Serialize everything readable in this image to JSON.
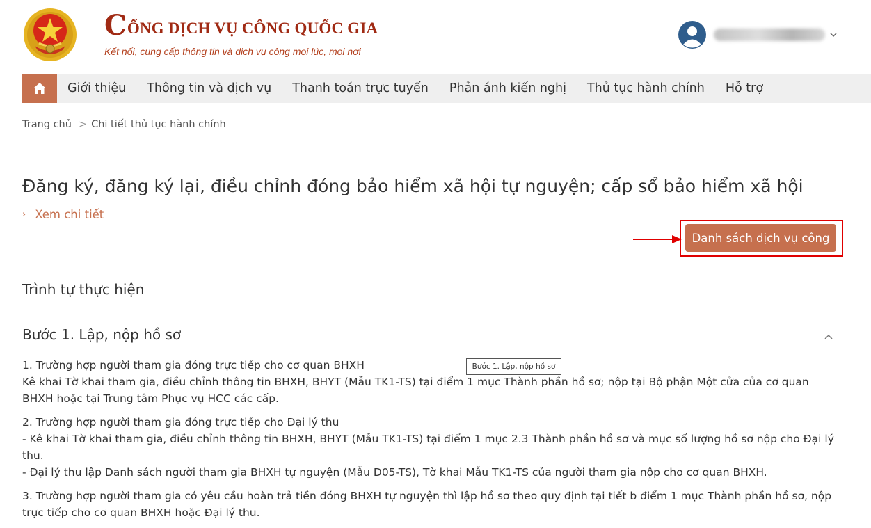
{
  "header": {
    "brand_initial": "C",
    "brand_rest": "ỔNG DỊCH VỤ CÔNG QUỐC GIA",
    "brand_subtitle": "Kết nối, cung cấp thông tin và dịch vụ công mọi lúc, mọi nơi",
    "user_icon": "user-avatar-icon",
    "dropdown_icon": "chevron-down-icon"
  },
  "nav": {
    "home_icon": "home-icon",
    "items": [
      "Giới thiệu",
      "Thông tin và dịch vụ",
      "Thanh toán trực tuyến",
      "Phản ánh kiến nghị",
      "Thủ tục hành chính",
      "Hỗ trợ"
    ]
  },
  "breadcrumb": {
    "home": "Trang chủ",
    "separator": ">",
    "current": "Chi tiết thủ tục hành chính"
  },
  "procedure": {
    "title": "Đăng ký, đăng ký lại, điều chỉnh đóng bảo hiểm xã hội tự nguyện; cấp sổ bảo hiểm xã hội",
    "detail_link_chevron": "›",
    "detail_link": "Xem chi tiết",
    "service_list_button": "Danh sách dịch vụ công"
  },
  "sequence": {
    "heading": "Trình tự thực hiện",
    "step_title": "Bước 1. Lập, nộp hồ sơ",
    "tooltip": "Bước 1. Lập, nộp hồ sơ",
    "paragraphs": [
      {
        "lines": [
          "1. Trường hợp người tham gia đóng trực tiếp cho cơ quan BHXH",
          "Kê khai Tờ khai tham gia, điều chỉnh thông tin BHXH, BHYT (Mẫu TK1-TS) tại điểm 1 mục Thành phần hồ sơ; nộp tại Bộ phận Một cửa của cơ quan BHXH hoặc tại Trung tâm Phục vụ HCC các cấp."
        ]
      },
      {
        "lines": [
          "2. Trường hợp người tham gia đóng trực tiếp cho Đại lý thu",
          "- Kê khai Tờ khai tham gia, điều chỉnh thông tin BHXH, BHYT (Mẫu TK1-TS) tại điểm 1 mục 2.3 Thành phần hồ sơ và mục số lượng hồ sơ nộp cho Đại lý thu.",
          "- Đại lý thu lập Danh sách người tham gia BHXH tự nguyện (Mẫu D05-TS), Tờ khai Mẫu TK1-TS của người tham gia nộp cho cơ quan BHXH."
        ]
      },
      {
        "lines": [
          "3. Trường hợp người tham gia có yêu cầu hoàn trả tiền đóng BHXH tự nguyện thì lập hồ sơ theo quy định tại tiết b điểm 1 mục Thành phần hồ sơ, nộp trực tiếp cho cơ quan BHXH hoặc Đại lý thu."
        ]
      }
    ]
  },
  "colors": {
    "accent": "#c6704e",
    "brand_red": "#a02a14",
    "highlight": "#e00000"
  }
}
